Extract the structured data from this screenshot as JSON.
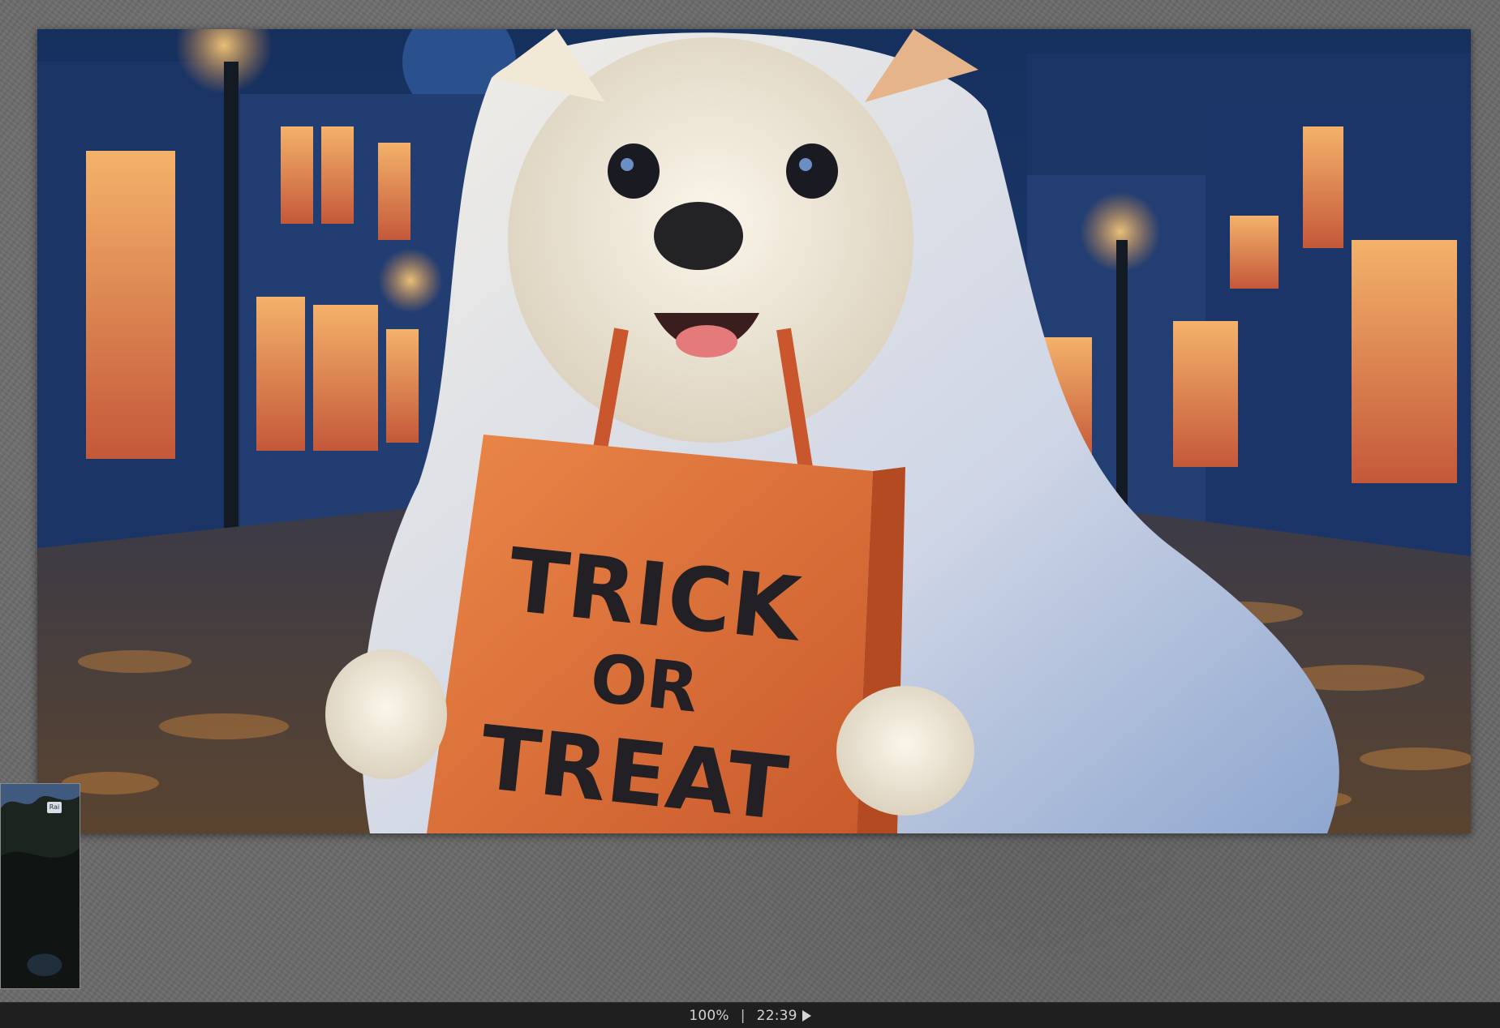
{
  "image": {
    "bag_text": [
      "TRICK",
      "OR",
      "TREAT"
    ]
  },
  "thumbnail": {
    "badge": "Rai"
  },
  "status_bar": {
    "zoom": "100%",
    "separator": "|",
    "time": "22:39",
    "play_icon": "play-icon"
  },
  "colors": {
    "background": "#6a6a6a",
    "status_bar": "#1f1f1f",
    "status_text": "#d4d4d4",
    "bag_orange": "#e0733a",
    "night_blue": "#1c3a6e"
  }
}
